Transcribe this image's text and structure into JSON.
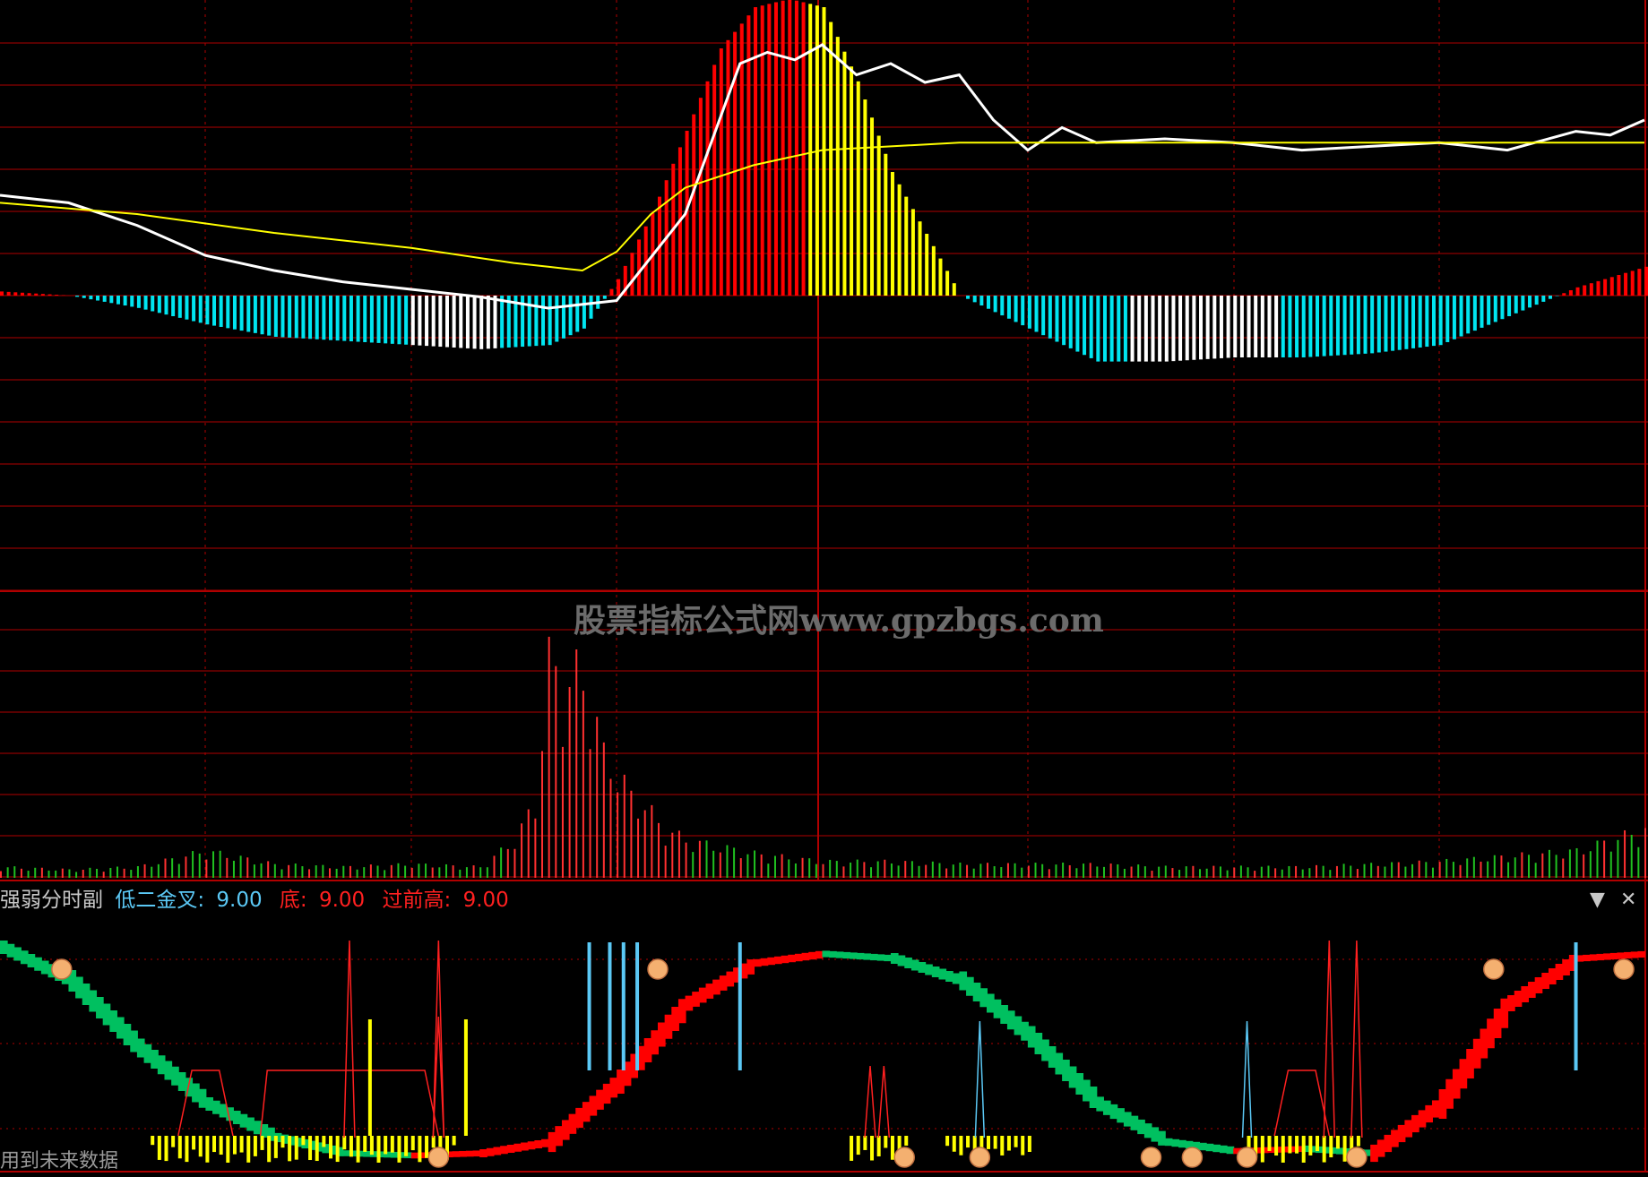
{
  "panel3": {
    "indicator_name": "强弱分时副",
    "items": [
      {
        "label": "低二金叉:",
        "value": "9.00",
        "color": "#5bc8f5"
      },
      {
        "label": "底:",
        "value": "9.00",
        "color": "#ff2020"
      },
      {
        "label": "过前高:",
        "value": "9.00",
        "color": "#ff2020"
      }
    ],
    "footnote": "用到未来数据"
  },
  "watermark": "股票指标公式网www.gpzbgs.com",
  "controls": {
    "menu_icon": "down-triangle-icon",
    "close_icon": "close-icon"
  },
  "colors": {
    "grid": "#b00000",
    "up": "#ff0000",
    "strong": "#ffff00",
    "down": "#00e5f0",
    "neutral": "#ffffff",
    "vol_up": "#ff3030",
    "vol_down": "#20c020",
    "band_up": "#ff0000",
    "band_down": "#00c060",
    "hand": "#f4b070"
  },
  "chart_data": [
    {
      "type": "line",
      "panel": "price-macd",
      "series": [
        {
          "color": "#ffffff",
          "x": [
            0,
            10,
            20,
            30,
            40,
            50,
            60,
            70,
            80,
            90,
            100,
            105,
            108,
            112,
            116,
            120,
            125,
            130,
            135,
            140,
            145,
            150,
            155,
            160,
            170,
            180,
            190,
            200,
            210,
            220,
            230,
            235,
            240
          ],
          "values": [
            60,
            58,
            52,
            44,
            40,
            37,
            35,
            33,
            30,
            32,
            55,
            80,
            95,
            98,
            96,
            100,
            92,
            95,
            90,
            92,
            80,
            72,
            78,
            74,
            75,
            74,
            72,
            73,
            74,
            72,
            77,
            76,
            80
          ]
        },
        {
          "color": "#ffff00",
          "x": [
            0,
            20,
            40,
            60,
            75,
            80,
            85,
            90,
            95,
            100,
            110,
            120,
            130,
            140,
            160,
            180,
            200,
            240
          ],
          "values": [
            58,
            55,
            50,
            46,
            42,
            41,
            40,
            45,
            55,
            62,
            68,
            72,
            73,
            74,
            74,
            74,
            74,
            74
          ]
        }
      ],
      "bars": {
        "x": [
          0,
          10,
          20,
          30,
          40,
          50,
          60,
          70,
          80,
          85,
          90,
          95,
          100,
          105,
          110,
          115,
          120,
          125,
          130,
          140,
          150,
          160,
          170,
          180,
          190,
          200,
          210,
          220,
          230,
          240
        ],
        "values": [
          1,
          0,
          -3,
          -7,
          -10,
          -11,
          -12,
          -13,
          -12,
          -8,
          4,
          20,
          40,
          60,
          70,
          72,
          70,
          52,
          30,
          0,
          -8,
          -16,
          -16,
          -15,
          -15,
          -14,
          -12,
          -5,
          2,
          7
        ]
      }
    },
    {
      "type": "bar",
      "panel": "volume",
      "x": [
        0,
        10,
        20,
        30,
        40,
        50,
        60,
        70,
        75,
        78,
        80,
        82,
        84,
        86,
        88,
        90,
        92,
        94,
        96,
        100,
        110,
        120,
        130,
        140,
        150,
        160,
        170,
        180,
        190,
        200,
        210,
        220,
        230,
        240
      ],
      "values": [
        4,
        3,
        4,
        10,
        5,
        4,
        5,
        4,
        14,
        28,
        80,
        72,
        75,
        70,
        45,
        40,
        30,
        28,
        20,
        14,
        9,
        6,
        6,
        5,
        5,
        5,
        4,
        4,
        4,
        5,
        6,
        8,
        10,
        18
      ]
    },
    {
      "type": "area",
      "panel": "strength",
      "x": [
        0,
        10,
        20,
        30,
        40,
        50,
        60,
        70,
        80,
        90,
        100,
        110,
        120,
        130,
        140,
        150,
        160,
        170,
        180,
        190,
        200,
        210,
        220,
        230,
        240
      ],
      "values": [
        95,
        80,
        50,
        25,
        10,
        3,
        2,
        3,
        8,
        35,
        70,
        88,
        92,
        90,
        80,
        55,
        25,
        8,
        4,
        5,
        3,
        25,
        70,
        90,
        92
      ]
    }
  ]
}
